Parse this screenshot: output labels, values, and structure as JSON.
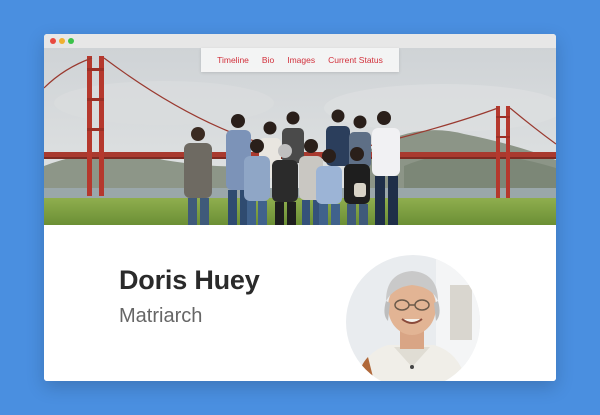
{
  "nav": {
    "items": [
      {
        "label": "Timeline"
      },
      {
        "label": "Bio"
      },
      {
        "label": "Images"
      },
      {
        "label": "Current Status"
      }
    ]
  },
  "profile": {
    "name": "Doris Huey",
    "role": "Matriarch"
  },
  "colors": {
    "background": "#4a8fe0",
    "nav_link": "#d2303b",
    "bridge": "#b5382d",
    "name_text": "#2a2a2a",
    "role_text": "#666666"
  },
  "icons": {
    "window_controls": [
      "close-dot",
      "minimize-dot",
      "maximize-dot"
    ]
  }
}
